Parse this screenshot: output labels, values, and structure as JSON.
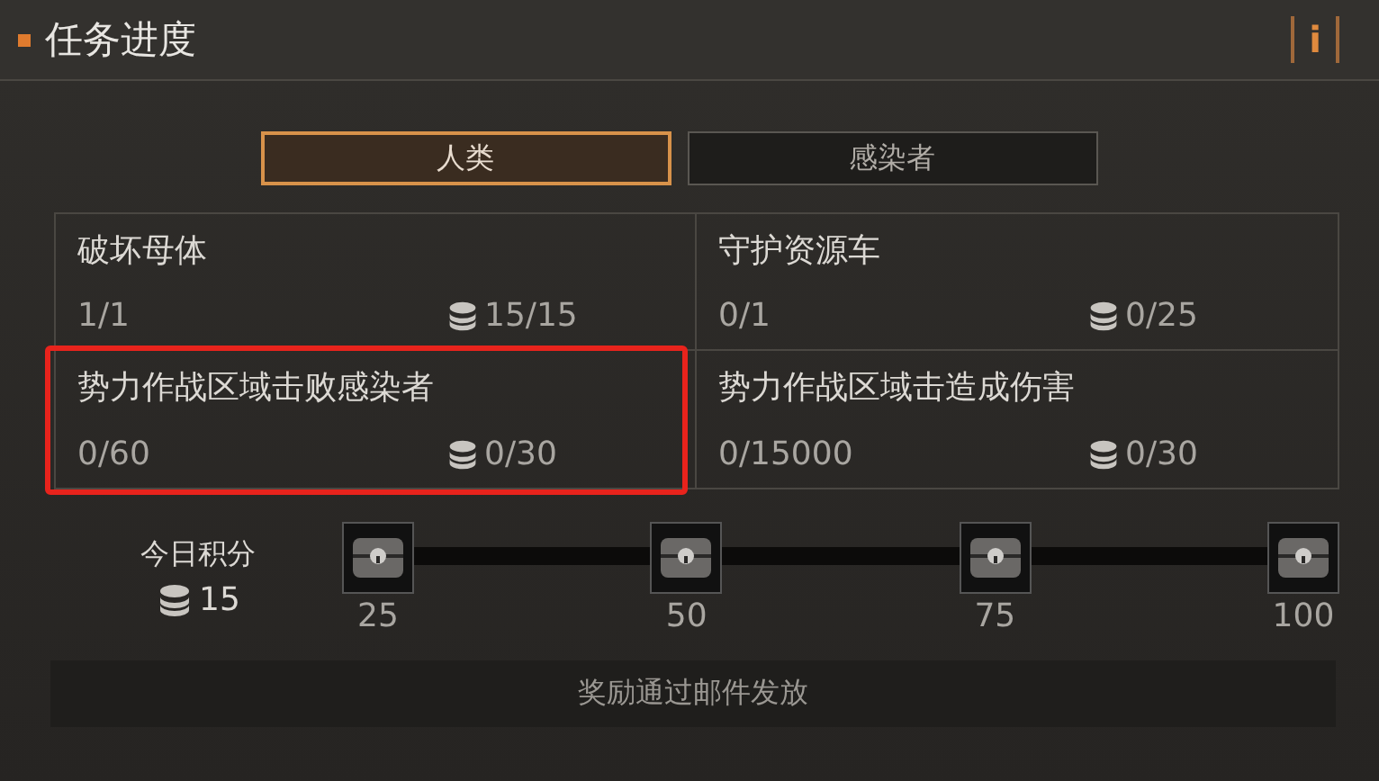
{
  "header": {
    "title": "任务进度",
    "info_button": "i"
  },
  "tabs": [
    {
      "label": "人类",
      "selected": true
    },
    {
      "label": "感染者",
      "selected": false
    }
  ],
  "tasks": [
    {
      "name": "破坏母体",
      "progress": "1/1",
      "reward": "15/15",
      "highlighted": false
    },
    {
      "name": "守护资源车",
      "progress": "0/1",
      "reward": "0/25",
      "highlighted": false
    },
    {
      "name": "势力作战区域击败感染者",
      "progress": "0/60",
      "reward": "0/30",
      "highlighted": true
    },
    {
      "name": "势力作战区域击造成伤害",
      "progress": "0/15000",
      "reward": "0/30",
      "highlighted": false
    }
  ],
  "daily_points": {
    "label": "今日积分",
    "value": "15"
  },
  "milestones": [
    "25",
    "50",
    "75",
    "100"
  ],
  "footer": "奖励通过邮件发放"
}
